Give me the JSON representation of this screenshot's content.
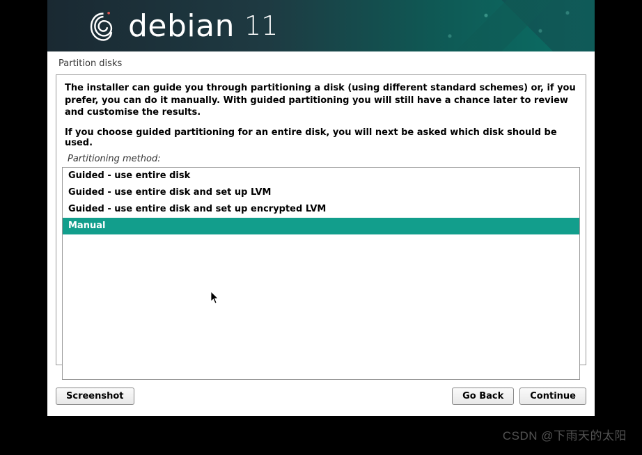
{
  "header": {
    "brand": "debian",
    "version": "11"
  },
  "page_title": "Partition disks",
  "intro_paragraph": "The installer can guide you through partitioning a disk (using different standard schemes) or, if you prefer, you can do it manually. With guided partitioning you will still have a chance later to review and customise the results.",
  "intro_paragraph2": "If you choose guided partitioning for an entire disk, you will next be asked which disk should be used.",
  "method_label": "Partitioning method:",
  "options": [
    {
      "label": "Guided - use entire disk",
      "selected": false
    },
    {
      "label": "Guided - use entire disk and set up LVM",
      "selected": false
    },
    {
      "label": "Guided - use entire disk and set up encrypted LVM",
      "selected": false
    },
    {
      "label": "Manual",
      "selected": true
    }
  ],
  "buttons": {
    "screenshot": "Screenshot",
    "go_back": "Go Back",
    "continue": "Continue"
  },
  "watermark": "CSDN @下雨天的太阳"
}
